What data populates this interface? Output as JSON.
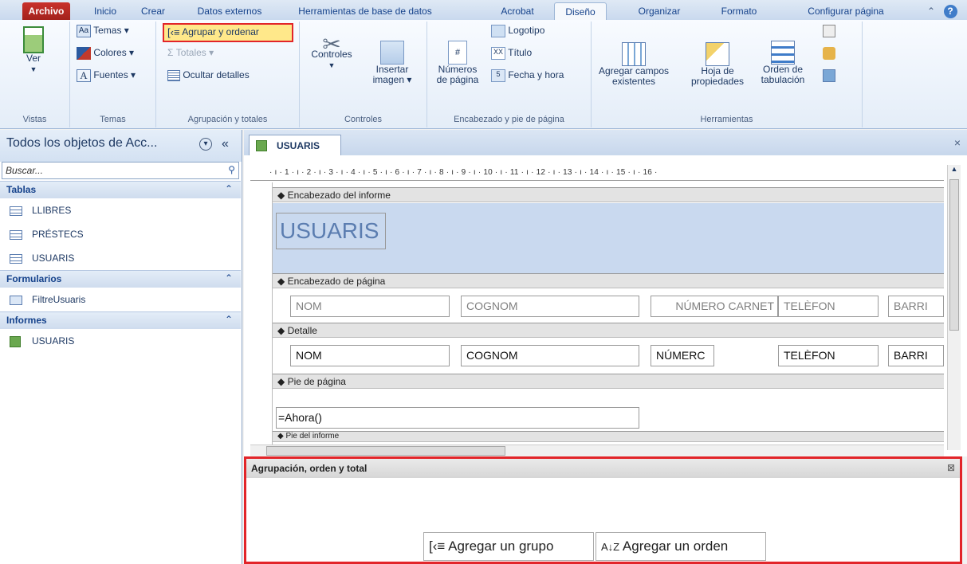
{
  "tabs": [
    "Archivo",
    "Inicio",
    "Crear",
    "Datos externos",
    "Herramientas de base de datos",
    "Acrobat",
    "Diseño",
    "Organizar",
    "Formato",
    "Configurar página"
  ],
  "ribbon": {
    "vistas": {
      "ver": "Ver",
      "label": "Vistas"
    },
    "temas": {
      "temas": "Temas",
      "colores": "Colores",
      "fuentes": "Fuentes",
      "label": "Temas"
    },
    "agrup": {
      "agrupar": "Agrupar y ordenar",
      "totales": "Totales",
      "ocultar": "Ocultar detalles",
      "label": "Agrupación y totales"
    },
    "controles": {
      "controles": "Controles",
      "insertar": "Insertar",
      "imagen": "imagen",
      "label": "Controles"
    },
    "encab": {
      "numeros": "Números",
      "depagina": "de página",
      "logotipo": "Logotipo",
      "titulo": "Título",
      "fecha": "Fecha y hora",
      "label": "Encabezado y pie de página"
    },
    "herr": {
      "agregar": "Agregar campos",
      "existentes": "existentes",
      "hoja": "Hoja de",
      "propiedades": "propiedades",
      "orden": "Orden de",
      "tabulacion": "tabulación",
      "label": "Herramientas"
    }
  },
  "nav": {
    "title": "Todos los objetos de Acc...",
    "search_placeholder": "Buscar...",
    "sections": [
      {
        "label": "Tablas",
        "items": [
          "LLIBRES",
          "PRÉSTECS",
          "USUARIS"
        ]
      },
      {
        "label": "Formularios",
        "items": [
          "FiltreUsuaris"
        ]
      },
      {
        "label": "Informes",
        "items": [
          "USUARIS"
        ]
      }
    ]
  },
  "doc": {
    "tab": "USUARIS",
    "ruler": "· ı · 1 · ı · 2 · ı · 3 · ı · 4 · ı · 5 · ı · 6 · ı · 7 · ı · 8 · ı · 9 · ı · 10 · ı · 11 · ı · 12 · ı · 13 · ı · 14 · ı · 15 · ı · 16 ·",
    "bands": {
      "encinf": "Encabezado del informe",
      "encpag": "Encabezado de página",
      "detalle": "Detalle",
      "pie": "Pie de página",
      "pieinf": "Pie del informe"
    },
    "report_title": "USUARIS",
    "header_fields": [
      "NOM",
      "COGNOM",
      "NÚMERO CARNET",
      "TELÈFON",
      "BARRI"
    ],
    "detail_fields": [
      "NOM",
      "COGNOM",
      "NÚMERC",
      "TELÈFON",
      "BARRI"
    ],
    "footer_expr": "=Ahora()"
  },
  "group_pane": {
    "title": "Agrupación, orden y total",
    "add_group": "Agregar un grupo",
    "add_sort": "Agregar un orden"
  }
}
